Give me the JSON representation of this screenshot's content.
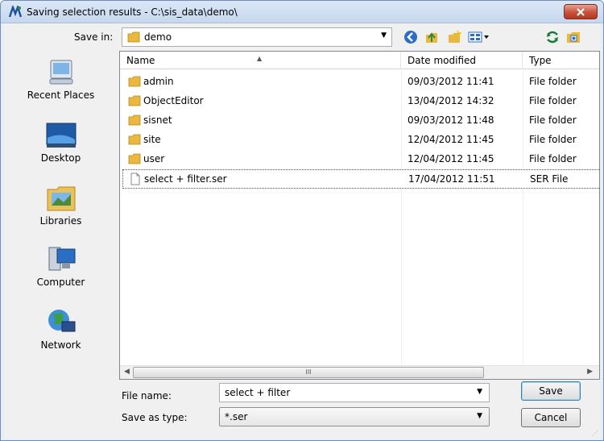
{
  "window": {
    "title": "Saving selection results - C:\\sis_data\\demo\\"
  },
  "save_in": {
    "label": "Save in:",
    "value": "demo"
  },
  "toolbar": [
    "back-icon",
    "up-folder-icon",
    "new-folder-icon",
    "view-menu-icon",
    "refresh-icon",
    "properties-icon"
  ],
  "places": [
    {
      "label": "Recent Places",
      "icon": "recent-places-icon"
    },
    {
      "label": "Desktop",
      "icon": "desktop-icon"
    },
    {
      "label": "Libraries",
      "icon": "libraries-icon"
    },
    {
      "label": "Computer",
      "icon": "computer-icon"
    },
    {
      "label": "Network",
      "icon": "network-icon"
    }
  ],
  "columns": {
    "name": "Name",
    "date": "Date modified",
    "type": "Type"
  },
  "files": [
    {
      "name": "admin",
      "date": "09/03/2012 11:41",
      "type": "File folder"
    },
    {
      "name": "ObjectEditor",
      "date": "13/04/2012 14:32",
      "type": "File folder"
    },
    {
      "name": "sisnet",
      "date": "09/03/2012 11:48",
      "type": "File folder"
    },
    {
      "name": "site",
      "date": "12/04/2012 11:45",
      "type": "File folder"
    },
    {
      "name": "user",
      "date": "12/04/2012 11:45",
      "type": "File folder"
    },
    {
      "name": "select + filter.ser",
      "date": "17/04/2012 11:51",
      "type": "SER File"
    }
  ],
  "file_name": {
    "label": "File name:",
    "value": "select + filter"
  },
  "save_as_type": {
    "label": "Save as type:",
    "value": "*.ser"
  },
  "buttons": {
    "save": "Save",
    "cancel": "Cancel"
  },
  "scrollbar": {
    "grip": "III"
  },
  "colors": {
    "folder": "#e9b83c",
    "title_bar": "#c6d7ee",
    "close": "#c9523d"
  }
}
